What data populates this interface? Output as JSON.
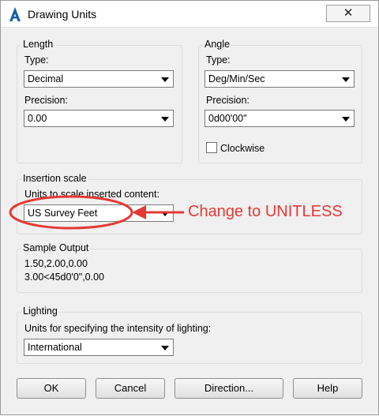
{
  "window": {
    "title": "Drawing Units",
    "close_symbol": "✕"
  },
  "length": {
    "group_title": "Length",
    "type_label": "Type:",
    "type_value": "Decimal",
    "precision_label": "Precision:",
    "precision_value": "0.00"
  },
  "angle": {
    "group_title": "Angle",
    "type_label": "Type:",
    "type_value": "Deg/Min/Sec",
    "precision_label": "Precision:",
    "precision_value": "0d00'00\"",
    "clockwise_label": "Clockwise",
    "clockwise_checked": false
  },
  "insertion": {
    "group_title": "Insertion scale",
    "units_label": "Units to scale inserted content:",
    "units_value": "US Survey Feet"
  },
  "sample": {
    "group_title": "Sample Output",
    "line1": "1.50,2.00,0.00",
    "line2": "3.00<45d0'0\",0.00"
  },
  "lighting": {
    "group_title": "Lighting",
    "units_label": "Units for specifying the intensity of lighting:",
    "units_value": "International"
  },
  "buttons": {
    "ok": "OK",
    "cancel": "Cancel",
    "direction": "Direction...",
    "help": "Help"
  },
  "annotation": {
    "text": "Change to UNITLESS",
    "color": "#e53935"
  }
}
